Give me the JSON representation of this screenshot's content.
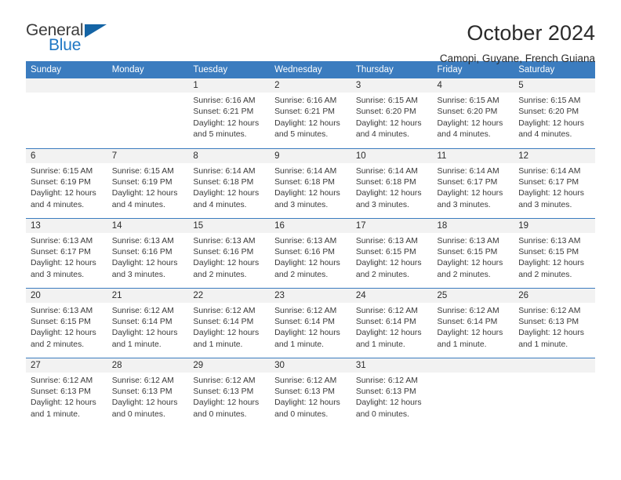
{
  "brand": {
    "word_one": "General",
    "word_two": "Blue",
    "triangle_color": "#1464a5",
    "blue_text_color": "#1f77c4"
  },
  "header": {
    "title": "October 2024",
    "subtitle": "Camopi, Guyane, French Guiana",
    "header_bg": "#3b7cbf",
    "daynum_bg": "#f2f2f2"
  },
  "weekday_headers": [
    "Sunday",
    "Monday",
    "Tuesday",
    "Wednesday",
    "Thursday",
    "Friday",
    "Saturday"
  ],
  "weeks": [
    [
      {
        "day": "",
        "empty": true
      },
      {
        "day": "",
        "empty": true
      },
      {
        "day": "1",
        "sunrise": "Sunrise: 6:16 AM",
        "sunset": "Sunset: 6:21 PM",
        "daylight_line1": "Daylight: 12 hours",
        "daylight_line2": "and 5 minutes."
      },
      {
        "day": "2",
        "sunrise": "Sunrise: 6:16 AM",
        "sunset": "Sunset: 6:21 PM",
        "daylight_line1": "Daylight: 12 hours",
        "daylight_line2": "and 5 minutes."
      },
      {
        "day": "3",
        "sunrise": "Sunrise: 6:15 AM",
        "sunset": "Sunset: 6:20 PM",
        "daylight_line1": "Daylight: 12 hours",
        "daylight_line2": "and 4 minutes."
      },
      {
        "day": "4",
        "sunrise": "Sunrise: 6:15 AM",
        "sunset": "Sunset: 6:20 PM",
        "daylight_line1": "Daylight: 12 hours",
        "daylight_line2": "and 4 minutes."
      },
      {
        "day": "5",
        "sunrise": "Sunrise: 6:15 AM",
        "sunset": "Sunset: 6:20 PM",
        "daylight_line1": "Daylight: 12 hours",
        "daylight_line2": "and 4 minutes."
      }
    ],
    [
      {
        "day": "6",
        "sunrise": "Sunrise: 6:15 AM",
        "sunset": "Sunset: 6:19 PM",
        "daylight_line1": "Daylight: 12 hours",
        "daylight_line2": "and 4 minutes."
      },
      {
        "day": "7",
        "sunrise": "Sunrise: 6:15 AM",
        "sunset": "Sunset: 6:19 PM",
        "daylight_line1": "Daylight: 12 hours",
        "daylight_line2": "and 4 minutes."
      },
      {
        "day": "8",
        "sunrise": "Sunrise: 6:14 AM",
        "sunset": "Sunset: 6:18 PM",
        "daylight_line1": "Daylight: 12 hours",
        "daylight_line2": "and 4 minutes."
      },
      {
        "day": "9",
        "sunrise": "Sunrise: 6:14 AM",
        "sunset": "Sunset: 6:18 PM",
        "daylight_line1": "Daylight: 12 hours",
        "daylight_line2": "and 3 minutes."
      },
      {
        "day": "10",
        "sunrise": "Sunrise: 6:14 AM",
        "sunset": "Sunset: 6:18 PM",
        "daylight_line1": "Daylight: 12 hours",
        "daylight_line2": "and 3 minutes."
      },
      {
        "day": "11",
        "sunrise": "Sunrise: 6:14 AM",
        "sunset": "Sunset: 6:17 PM",
        "daylight_line1": "Daylight: 12 hours",
        "daylight_line2": "and 3 minutes."
      },
      {
        "day": "12",
        "sunrise": "Sunrise: 6:14 AM",
        "sunset": "Sunset: 6:17 PM",
        "daylight_line1": "Daylight: 12 hours",
        "daylight_line2": "and 3 minutes."
      }
    ],
    [
      {
        "day": "13",
        "sunrise": "Sunrise: 6:13 AM",
        "sunset": "Sunset: 6:17 PM",
        "daylight_line1": "Daylight: 12 hours",
        "daylight_line2": "and 3 minutes."
      },
      {
        "day": "14",
        "sunrise": "Sunrise: 6:13 AM",
        "sunset": "Sunset: 6:16 PM",
        "daylight_line1": "Daylight: 12 hours",
        "daylight_line2": "and 3 minutes."
      },
      {
        "day": "15",
        "sunrise": "Sunrise: 6:13 AM",
        "sunset": "Sunset: 6:16 PM",
        "daylight_line1": "Daylight: 12 hours",
        "daylight_line2": "and 2 minutes."
      },
      {
        "day": "16",
        "sunrise": "Sunrise: 6:13 AM",
        "sunset": "Sunset: 6:16 PM",
        "daylight_line1": "Daylight: 12 hours",
        "daylight_line2": "and 2 minutes."
      },
      {
        "day": "17",
        "sunrise": "Sunrise: 6:13 AM",
        "sunset": "Sunset: 6:15 PM",
        "daylight_line1": "Daylight: 12 hours",
        "daylight_line2": "and 2 minutes."
      },
      {
        "day": "18",
        "sunrise": "Sunrise: 6:13 AM",
        "sunset": "Sunset: 6:15 PM",
        "daylight_line1": "Daylight: 12 hours",
        "daylight_line2": "and 2 minutes."
      },
      {
        "day": "19",
        "sunrise": "Sunrise: 6:13 AM",
        "sunset": "Sunset: 6:15 PM",
        "daylight_line1": "Daylight: 12 hours",
        "daylight_line2": "and 2 minutes."
      }
    ],
    [
      {
        "day": "20",
        "sunrise": "Sunrise: 6:13 AM",
        "sunset": "Sunset: 6:15 PM",
        "daylight_line1": "Daylight: 12 hours",
        "daylight_line2": "and 2 minutes."
      },
      {
        "day": "21",
        "sunrise": "Sunrise: 6:12 AM",
        "sunset": "Sunset: 6:14 PM",
        "daylight_line1": "Daylight: 12 hours",
        "daylight_line2": "and 1 minute."
      },
      {
        "day": "22",
        "sunrise": "Sunrise: 6:12 AM",
        "sunset": "Sunset: 6:14 PM",
        "daylight_line1": "Daylight: 12 hours",
        "daylight_line2": "and 1 minute."
      },
      {
        "day": "23",
        "sunrise": "Sunrise: 6:12 AM",
        "sunset": "Sunset: 6:14 PM",
        "daylight_line1": "Daylight: 12 hours",
        "daylight_line2": "and 1 minute."
      },
      {
        "day": "24",
        "sunrise": "Sunrise: 6:12 AM",
        "sunset": "Sunset: 6:14 PM",
        "daylight_line1": "Daylight: 12 hours",
        "daylight_line2": "and 1 minute."
      },
      {
        "day": "25",
        "sunrise": "Sunrise: 6:12 AM",
        "sunset": "Sunset: 6:14 PM",
        "daylight_line1": "Daylight: 12 hours",
        "daylight_line2": "and 1 minute."
      },
      {
        "day": "26",
        "sunrise": "Sunrise: 6:12 AM",
        "sunset": "Sunset: 6:13 PM",
        "daylight_line1": "Daylight: 12 hours",
        "daylight_line2": "and 1 minute."
      }
    ],
    [
      {
        "day": "27",
        "sunrise": "Sunrise: 6:12 AM",
        "sunset": "Sunset: 6:13 PM",
        "daylight_line1": "Daylight: 12 hours",
        "daylight_line2": "and 1 minute."
      },
      {
        "day": "28",
        "sunrise": "Sunrise: 6:12 AM",
        "sunset": "Sunset: 6:13 PM",
        "daylight_line1": "Daylight: 12 hours",
        "daylight_line2": "and 0 minutes."
      },
      {
        "day": "29",
        "sunrise": "Sunrise: 6:12 AM",
        "sunset": "Sunset: 6:13 PM",
        "daylight_line1": "Daylight: 12 hours",
        "daylight_line2": "and 0 minutes."
      },
      {
        "day": "30",
        "sunrise": "Sunrise: 6:12 AM",
        "sunset": "Sunset: 6:13 PM",
        "daylight_line1": "Daylight: 12 hours",
        "daylight_line2": "and 0 minutes."
      },
      {
        "day": "31",
        "sunrise": "Sunrise: 6:12 AM",
        "sunset": "Sunset: 6:13 PM",
        "daylight_line1": "Daylight: 12 hours",
        "daylight_line2": "and 0 minutes."
      },
      {
        "day": "",
        "empty": true
      },
      {
        "day": "",
        "empty": true
      }
    ]
  ]
}
